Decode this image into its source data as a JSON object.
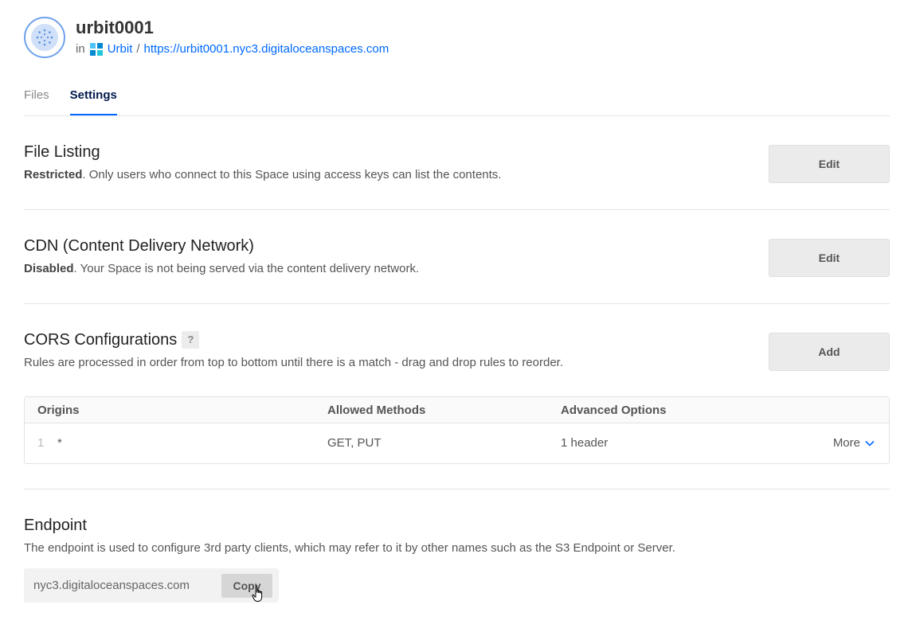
{
  "header": {
    "space_name": "urbit0001",
    "in_label": "in",
    "project_name": "Urbit",
    "separator": "/",
    "space_url": "https://urbit0001.nyc3.digitaloceanspaces.com"
  },
  "tabs": [
    {
      "label": "Files",
      "active": false
    },
    {
      "label": "Settings",
      "active": true
    }
  ],
  "file_listing": {
    "title": "File Listing",
    "status": "Restricted",
    "description": ". Only users who connect to this Space using access keys can list the contents.",
    "button": "Edit"
  },
  "cdn": {
    "title": "CDN (Content Delivery Network)",
    "status": "Disabled",
    "description": ". Your Space is not being served via the content delivery network.",
    "button": "Edit"
  },
  "cors": {
    "title": "CORS Configurations",
    "help": "?",
    "description": "Rules are processed in order from top to bottom until there is a match - drag and drop rules to reorder.",
    "button": "Add",
    "columns": [
      "Origins",
      "Allowed Methods",
      "Advanced Options"
    ],
    "rows": [
      {
        "index": "1",
        "origin": "*",
        "methods": "GET, PUT",
        "advanced": "1 header",
        "more": "More"
      }
    ]
  },
  "endpoint": {
    "title": "Endpoint",
    "description": "The endpoint is used to configure 3rd party clients, which may refer to it by other names such as the S3 Endpoint or Server.",
    "value": "nyc3.digitaloceanspaces.com",
    "copy_label": "Copy"
  },
  "colors": {
    "accent": "#0069ff",
    "button_bg": "#ebebeb",
    "divider": "#e5e5e5"
  },
  "icons": {
    "space": "space-bucket-icon",
    "project": "project-icon",
    "more": "chevron-down-icon",
    "cursor": "hand-pointer-icon"
  }
}
